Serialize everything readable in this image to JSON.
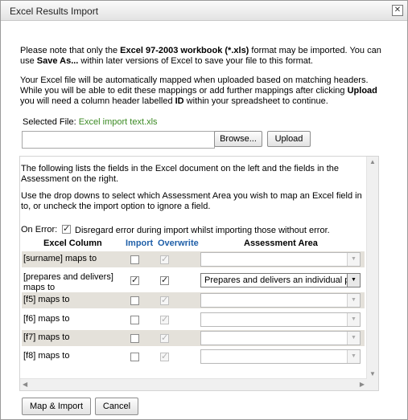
{
  "dialog": {
    "title": "Excel Results Import",
    "close_glyph": "✕"
  },
  "notice": {
    "part1": "Please note that only the ",
    "format_bold": "Excel 97-2003 workbook (*.xls)",
    "part2": " format may be imported. You can use ",
    "save_as_bold": "Save As...",
    "part3": " within later versions of Excel to save your file to this format."
  },
  "mapping_info": {
    "part1": "Your Excel file will be automatically mapped when uploaded based on matching headers. While you will be able to edit these mappings or add further mappings after clicking ",
    "upload_bold": "Upload",
    "part2": " you will need a column header labelled ",
    "id_bold": "ID",
    "part3": " within your spreadsheet to continue."
  },
  "file": {
    "selected_label": "Selected File:",
    "selected_name": "Excel import text.xls",
    "input_value": "",
    "browse_label": "Browse...",
    "upload_label": "Upload"
  },
  "panel": {
    "intro": "The following lists the fields in the Excel document on the left and the fields in the Assessment on the right.",
    "instructions": "Use the drop downs to select which Assessment Area you wish to map an Excel field in to, or uncheck the import option to ignore a field.",
    "on_error_label": "On Error:",
    "on_error_checked": true,
    "on_error_text": "Disregard error during import whilst importing those without error.",
    "headers": {
      "excel_column": "Excel Column",
      "import": "Import",
      "overwrite": "Overwrite",
      "assessment_area": "Assessment Area"
    },
    "rows": [
      {
        "label": "[surname] maps to",
        "import": false,
        "overwrite": true,
        "area": "",
        "active": false
      },
      {
        "label": "[prepares and delivers] maps to",
        "import": true,
        "overwrite": true,
        "area": "Prepares and delivers an individual p",
        "active": true
      },
      {
        "label": "[f5] maps to",
        "import": false,
        "overwrite": true,
        "area": "",
        "active": false
      },
      {
        "label": "[f6] maps to",
        "import": false,
        "overwrite": true,
        "area": "",
        "active": false
      },
      {
        "label": "[f7] maps to",
        "import": false,
        "overwrite": true,
        "area": "",
        "active": false
      },
      {
        "label": "[f8] maps to",
        "import": false,
        "overwrite": true,
        "area": "",
        "active": false
      }
    ]
  },
  "footer": {
    "map_import_label": "Map & Import",
    "cancel_label": "Cancel"
  },
  "icons": {
    "dropdown": "▼",
    "scroll_up": "▲",
    "scroll_down": "▼",
    "scroll_left": "◀",
    "scroll_right": "▶"
  }
}
